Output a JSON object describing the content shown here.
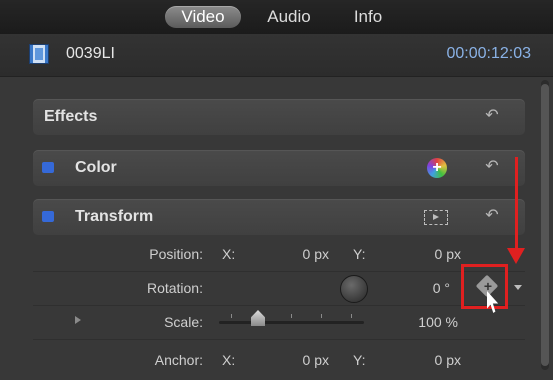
{
  "tabs": [
    {
      "label": "Video",
      "active": true
    },
    {
      "label": "Audio",
      "active": false
    },
    {
      "label": "Info",
      "active": false
    }
  ],
  "clip": {
    "name": "0039LI",
    "timecode": "00:00:12:03",
    "icon": "film-icon"
  },
  "sections": {
    "effects": {
      "title": "Effects"
    },
    "color": {
      "title": "Color",
      "enabled": true
    },
    "transform": {
      "title": "Transform",
      "enabled": true
    }
  },
  "transform": {
    "position": {
      "label": "Position:",
      "x_label": "X:",
      "x_value": "0 px",
      "y_label": "Y:",
      "y_value": "0 px"
    },
    "rotation": {
      "label": "Rotation:",
      "value": "0 °"
    },
    "scale": {
      "label": "Scale:",
      "value": "100 %"
    },
    "anchor": {
      "label": "Anchor:",
      "x_label": "X:",
      "x_value": "0 px",
      "y_label": "Y:",
      "y_value": "0 px"
    }
  },
  "icons": {
    "reset": "reset-icon",
    "color_add": "color-add-icon",
    "transform_onscreen": "transform-onscreen-icon",
    "keyframe": "keyframe-button",
    "disclosure": "disclosure-triangle-icon"
  },
  "colors": {
    "accent_blue": "#3569d8",
    "timecode_blue": "#8ab2e6",
    "annotation_red": "#e02020"
  }
}
